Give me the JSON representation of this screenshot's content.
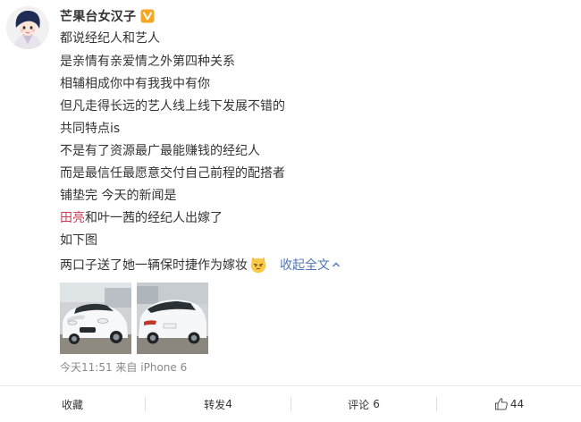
{
  "author": {
    "name": "芒果台女汉子",
    "avatar_icon": "cartoon-avatar",
    "badge_icon": "verified-v-icon",
    "badge_color": "#f6a623"
  },
  "post": {
    "lines": [
      "都说经纪人和艺人",
      "是亲情有亲爱情之外第四种关系",
      "相辅相成你中有我我中有你",
      "但凡走得长远的艺人线上线下发展不错的",
      "共同特点is",
      "不是有了资源最广最能赚钱的经纪人",
      "而是最信任最愿意交付自己前程的配搭者",
      "铺垫完 今天的新闻是"
    ],
    "mention_name": "田亮",
    "mention_rest": "和叶一茜的经纪人出嫁了",
    "line_after_mention": "如下图",
    "last_line_text": "两口子送了她一辆保时捷作为嫁妆",
    "emoji_icon": "cat-emoji-icon",
    "collapse_label": "收起全文",
    "collapse_icon": "chevron-up-icon"
  },
  "photos": [
    {
      "name": "white-porsche-front-photo"
    },
    {
      "name": "white-porsche-rear-photo"
    }
  ],
  "meta": {
    "time": "今天11:51",
    "from_label": "来自",
    "source": "iPhone 6"
  },
  "actions": {
    "favorite_label": "收藏",
    "repost_label": "转发",
    "repost_count": "4",
    "comment_label": "评论",
    "comment_count": "6",
    "like_icon": "thumbs-up-icon",
    "like_count": "44"
  },
  "colors": {
    "text": "#333333",
    "link_blue": "#4e77b5",
    "mention_red": "#cb3d57",
    "meta_gray": "#888888"
  }
}
